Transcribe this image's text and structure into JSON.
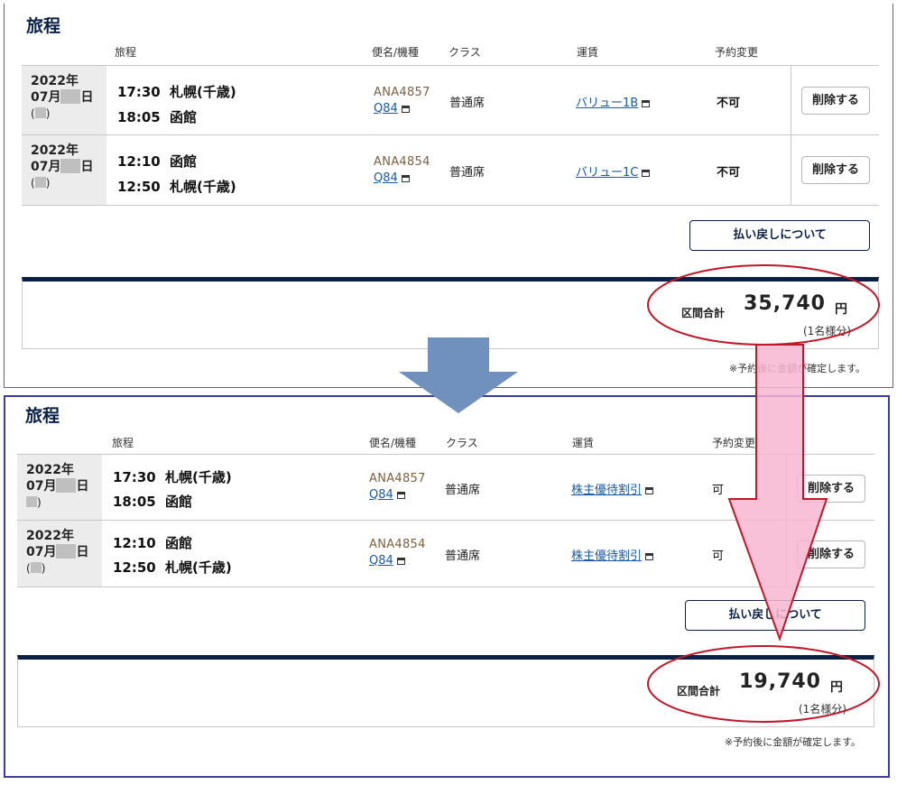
{
  "top": {
    "title": "旅程",
    "headers": {
      "itinerary": "旅程",
      "flight": "便名/機種",
      "class": "クラス",
      "fare": "運賃",
      "change": "予約変更"
    },
    "rows": [
      {
        "year": "2022年",
        "month": "07月",
        "day_suffix": "日",
        "dow_open": "(",
        "dow_close": ")",
        "dep_time": "17:30",
        "dep_place": "札幌(千歳)",
        "arr_time": "18:05",
        "arr_place": "函館",
        "flight_no": "ANA4857",
        "aircraft": "Q84",
        "class": "普通席",
        "fare": "バリュー1B",
        "change": "不可",
        "delete": "削除する"
      },
      {
        "year": "2022年",
        "month": "07月",
        "day_suffix": "日",
        "dow_open": "(",
        "dow_close": ")",
        "dep_time": "12:10",
        "dep_place": "函館",
        "arr_time": "12:50",
        "arr_place": "札幌(千歳)",
        "flight_no": "ANA4854",
        "aircraft": "Q84",
        "class": "普通席",
        "fare": "バリュー1C",
        "change": "不可",
        "delete": "削除する"
      }
    ],
    "refund_button": "払い戻しについて",
    "total_label": "区間合計",
    "total_amount": "35,740",
    "total_unit": "円",
    "total_per": "(1名様分)",
    "note": "※予約後に金額が確定します。"
  },
  "bottom": {
    "title": "旅程",
    "headers": {
      "itinerary": "旅程",
      "flight": "便名/機種",
      "class": "クラス",
      "fare": "運賃",
      "change": "予約変更"
    },
    "rows": [
      {
        "year": "2022年",
        "month": "07月",
        "day_suffix": "日",
        "dow_open": "",
        "dow_close": ")",
        "dep_time": "17:30",
        "dep_place": "札幌(千歳)",
        "arr_time": "18:05",
        "arr_place": "函館",
        "flight_no": "ANA4857",
        "aircraft": "Q84",
        "class": "普通席",
        "fare": "株主優待割引",
        "change": "可",
        "delete": "削除する"
      },
      {
        "year": "2022年",
        "month": "07月",
        "day_suffix": "日",
        "dow_open": "(",
        "dow_close": ")",
        "dep_time": "12:10",
        "dep_place": "函館",
        "arr_time": "12:50",
        "arr_place": "札幌(千歳)",
        "flight_no": "ANA4854",
        "aircraft": "Q84",
        "class": "普通席",
        "fare": "株主優待割引",
        "change": "可",
        "delete": "削除する"
      }
    ],
    "refund_button": "払い戻しについて",
    "total_label": "区間合計",
    "total_amount": "19,740",
    "total_unit": "円",
    "total_per": "(1名様分)",
    "note": "※予約後に金額が確定します。"
  },
  "colors": {
    "navy": "#0a2145",
    "link": "#1a5aa6",
    "flight_no": "#7a6040",
    "ellipse": "#c0182a",
    "pink_arrow": "#f7b6d0",
    "blue_arrow": "#7090bd",
    "panel_border": "#3c3c9a"
  },
  "icons": {
    "window": "external-window-icon",
    "down_arrow": "down-arrow-icon",
    "pink_arrow": "pink-down-arrow-icon",
    "highlight": "highlight-ellipse"
  }
}
